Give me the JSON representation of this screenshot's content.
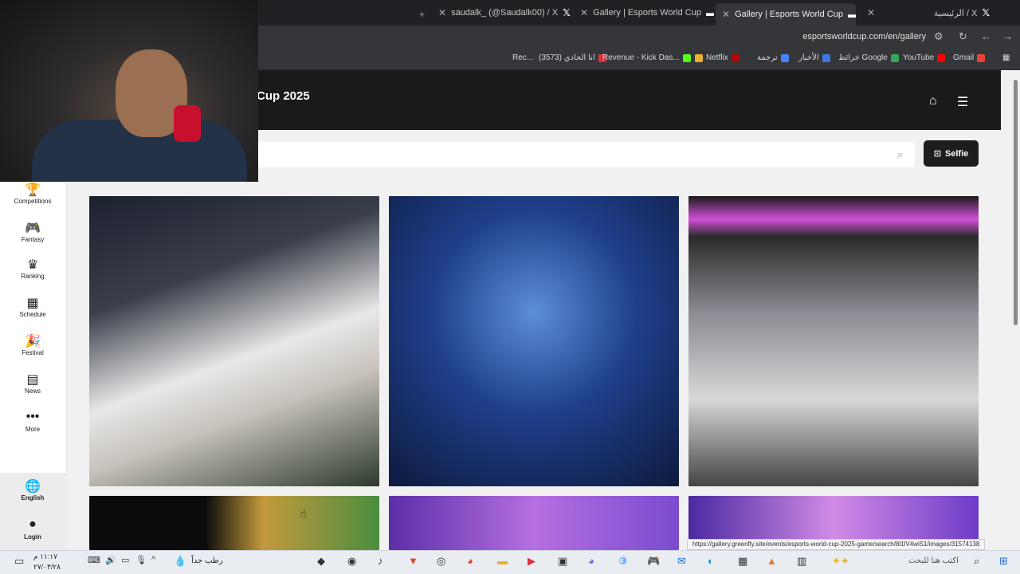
{
  "browser": {
    "tabs": [
      {
        "title": "saudalk_ (@Saudalk00) / X",
        "icon": "x-logo-icon"
      },
      {
        "title": "Gallery | Esports World Cup",
        "icon": "ewc-logo-icon"
      },
      {
        "title": "Gallery | Esports World Cup",
        "icon": "ewc-logo-icon",
        "active": true
      },
      {
        "title": "الرئيسية / X",
        "icon": "x-logo-icon"
      }
    ],
    "url": "esportsworldcup.com/en/gallery",
    "bookmarks": [
      "Rec...",
      "انا الحادي (3573)",
      "Revenue - Kick Das...",
      "Netflix",
      "ترجمة",
      "الأخبار",
      "خرائط Google",
      "YouTube",
      "Gmail"
    ]
  },
  "site": {
    "title": "Cup 2025",
    "selfie_label": "Selfie",
    "search_placeholder": ""
  },
  "sidebar": {
    "items": [
      {
        "label": "Competitions",
        "icon": "trophy-icon"
      },
      {
        "label": "Fantasy",
        "icon": "gamepad-icon"
      },
      {
        "label": "Ranking",
        "icon": "crown-icon"
      },
      {
        "label": "Schedule",
        "icon": "calendar-icon"
      },
      {
        "label": "Festival",
        "icon": "confetti-icon"
      },
      {
        "label": "News",
        "icon": "newspaper-icon"
      },
      {
        "label": "More",
        "icon": "more-dots-icon"
      }
    ],
    "bottom": [
      {
        "label": "English",
        "icon": "globe-icon"
      },
      {
        "label": "Login",
        "icon": "user-icon"
      }
    ]
  },
  "status_url": "https://gallery.greenfly.site/events/esports-world-cup-2025-game/search/8l1lV4wiS1/images/31574138",
  "taskbar": {
    "weather": "رطب جداً",
    "search_placeholder": "اكتب هنا للبحث",
    "time": "١١:١٧ م",
    "date": "٢٧/٠٣/٢٨"
  }
}
